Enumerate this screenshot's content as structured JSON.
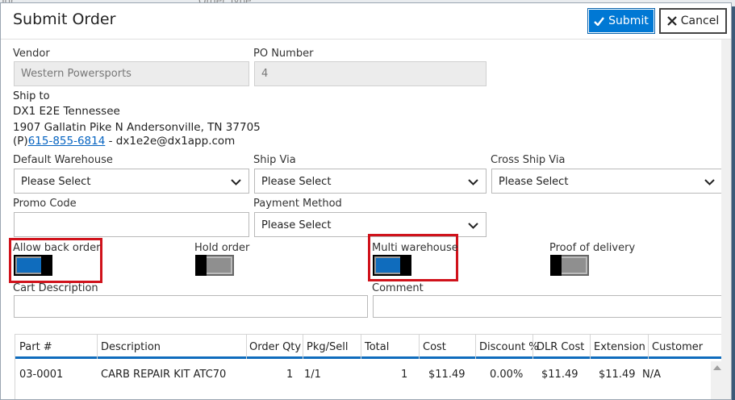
{
  "dialog": {
    "title": "Submit Order",
    "submit_label": "Submit",
    "cancel_label": "Cancel"
  },
  "backdrop": {
    "faint_a": "gor",
    "faint_b": "Order Type"
  },
  "vendor": {
    "label": "Vendor",
    "value": "Western Powersports"
  },
  "po": {
    "label": "PO Number",
    "value": "4"
  },
  "ship_to": {
    "label": "Ship to",
    "name": "DX1 E2E Tennessee",
    "address": "1907 Gallatin Pike N Andersonville, TN 37705",
    "phone_prefix": "(P)",
    "phone": "615-855-6814",
    "email_sep": " - dx1e2e@dx1app.com"
  },
  "default_warehouse": {
    "label": "Default Warehouse",
    "value": "Please Select"
  },
  "ship_via": {
    "label": "Ship Via",
    "value": "Please Select"
  },
  "cross_ship_via": {
    "label": "Cross Ship Via",
    "value": "Please Select"
  },
  "promo_code": {
    "label": "Promo Code",
    "value": ""
  },
  "payment_method": {
    "label": "Payment Method",
    "value": "Please Select"
  },
  "toggles": {
    "allow_back_order": {
      "label": "Allow back order",
      "on": true
    },
    "hold_order": {
      "label": "Hold order",
      "on": false
    },
    "multi_warehouse": {
      "label": "Multi warehouse",
      "on": true
    },
    "proof_of_delivery": {
      "label": "Proof of delivery",
      "on": false
    }
  },
  "cart_description": {
    "label": "Cart Description",
    "value": ""
  },
  "comment": {
    "label": "Comment",
    "value": ""
  },
  "table": {
    "headers": [
      "Part #",
      "Description",
      "Order Qty",
      "Pkg/Sell",
      "Total",
      "Cost",
      "Discount %",
      "DLR Cost",
      "Extension",
      "Customer"
    ],
    "rows": [
      [
        "03-0001",
        "CARB REPAIR KIT ATC70",
        "1",
        "1/1",
        "1",
        "$11.49",
        "0.00%",
        "$11.49",
        "$11.49",
        "N/A"
      ]
    ]
  },
  "colors": {
    "accent": "#0078d4",
    "highlight": "#d0121b",
    "toggle_on": "#0f6cbd"
  }
}
